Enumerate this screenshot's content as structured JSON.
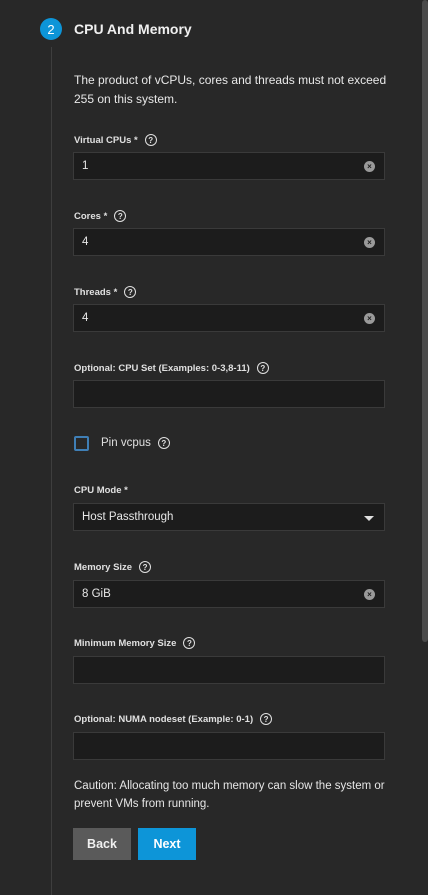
{
  "step": {
    "number": "2",
    "title": "CPU And Memory"
  },
  "description": "The product of vCPUs, cores and threads must not exceed 255 on this system.",
  "fields": {
    "vcpus": {
      "label": "Virtual CPUs *",
      "value": "1"
    },
    "cores": {
      "label": "Cores *",
      "value": "4"
    },
    "threads": {
      "label": "Threads *",
      "value": "4"
    },
    "cpuset": {
      "label": "Optional: CPU Set (Examples: 0-3,8-11)",
      "value": ""
    },
    "pin_vcpus": {
      "label": "Pin vcpus",
      "checked": false
    },
    "cpu_mode": {
      "label": "CPU Mode *",
      "value": "Host Passthrough"
    },
    "memory_size": {
      "label": "Memory Size",
      "value": "8 GiB"
    },
    "min_memory": {
      "label": "Minimum Memory Size",
      "value": ""
    },
    "numa_nodeset": {
      "label": "Optional: NUMA nodeset (Example: 0-1)",
      "value": ""
    }
  },
  "caution": "Caution: Allocating too much memory can slow the system or prevent VMs from running.",
  "buttons": {
    "back": "Back",
    "next": "Next"
  },
  "icons": {
    "help": "help-circle-icon",
    "clear": "clear-x-icon",
    "dropdown": "caret-down-icon"
  },
  "colors": {
    "accent": "#0d95d8",
    "background": "#282828",
    "field_bg": "#1c1c1c",
    "back_button": "#5a5a5a"
  }
}
